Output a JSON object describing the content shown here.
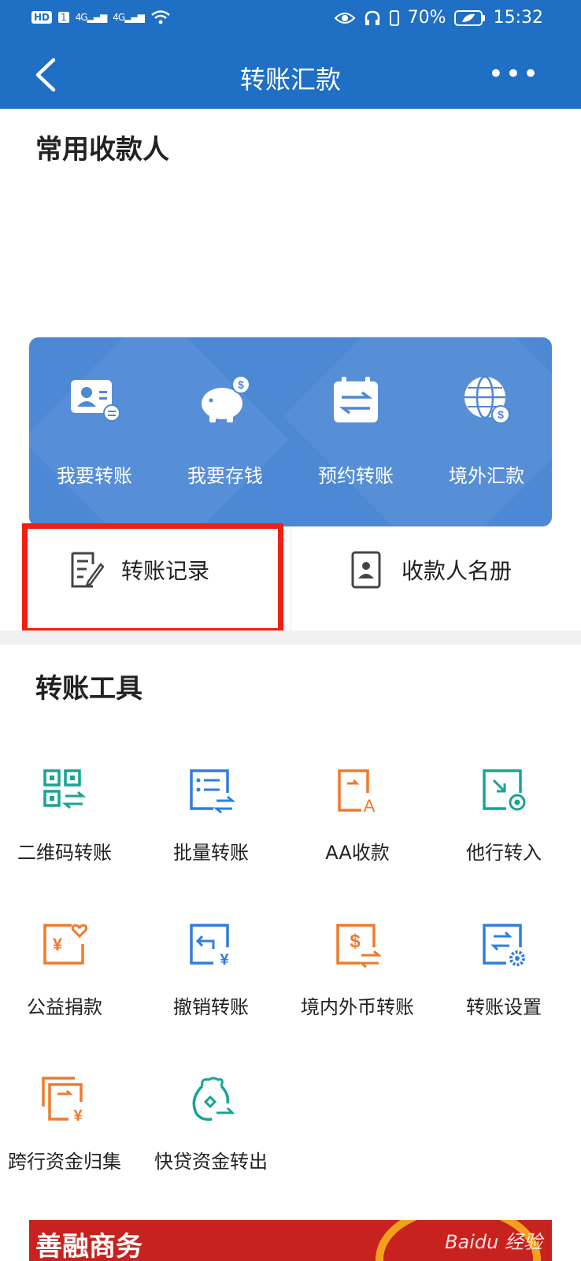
{
  "status_bar": {
    "hd": "HD",
    "sim": "1",
    "signal1": "4G",
    "signal2": "4G",
    "battery": "70%",
    "time": "15:32"
  },
  "nav": {
    "title": "转账汇款",
    "more": "•••"
  },
  "frequent_payees": {
    "title": "常用收款人"
  },
  "quick_actions": [
    {
      "label": "我要转账",
      "icon": "payee-card-icon"
    },
    {
      "label": "我要存钱",
      "icon": "piggy-bank-icon"
    },
    {
      "label": "预约转账",
      "icon": "calendar-transfer-icon"
    },
    {
      "label": "境外汇款",
      "icon": "globe-dollar-icon"
    }
  ],
  "secondary_actions": {
    "records": "转账记录",
    "payee_book": "收款人名册"
  },
  "tools": {
    "title": "转账工具",
    "items": [
      {
        "label": "二维码转账",
        "icon": "qr-transfer-icon"
      },
      {
        "label": "批量转账",
        "icon": "batch-transfer-icon"
      },
      {
        "label": "AA收款",
        "icon": "aa-collect-icon"
      },
      {
        "label": "他行转入",
        "icon": "other-bank-in-icon"
      },
      {
        "label": "公益捐款",
        "icon": "charity-donation-icon"
      },
      {
        "label": "撤销转账",
        "icon": "cancel-transfer-icon"
      },
      {
        "label": "境内外币转账",
        "icon": "domestic-fx-transfer-icon"
      },
      {
        "label": "转账设置",
        "icon": "transfer-settings-icon"
      },
      {
        "label": "跨行资金归集",
        "icon": "interbank-pooling-icon"
      },
      {
        "label": "快贷资金转出",
        "icon": "quick-loan-out-icon"
      }
    ]
  },
  "banner": {
    "title": "善融商务",
    "watermark": "Baidu 经验"
  },
  "colors": {
    "brand_blue": "#1f6fc4",
    "card_blue": "#4d88d5",
    "teal": "#1aa394",
    "blue_icon": "#2d7fe0",
    "orange": "#f07a2c",
    "highlight_red": "#f11f0f"
  }
}
